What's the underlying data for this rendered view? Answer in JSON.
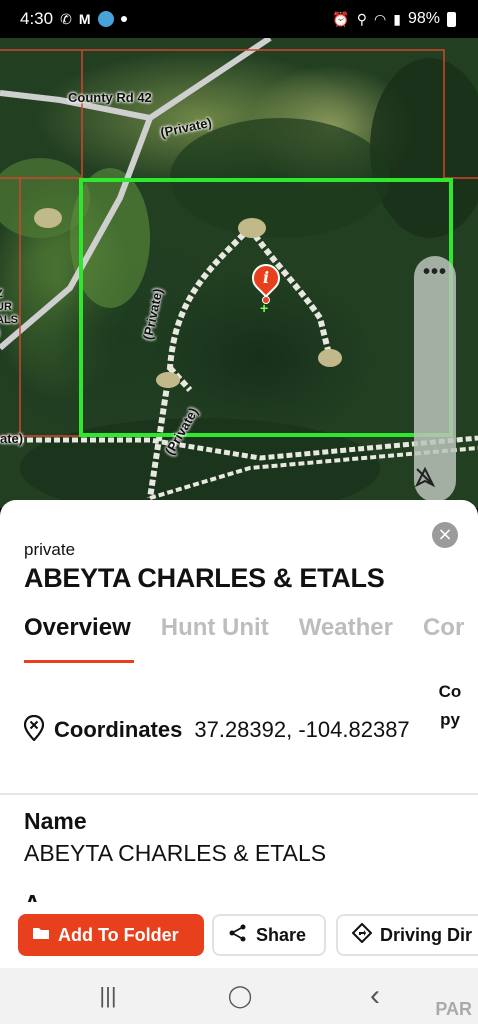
{
  "status_bar": {
    "time": "4:30",
    "battery": "98%",
    "icons": [
      "wifi-call-icon",
      "gmail-icon",
      "location-app-icon",
      "notification-dot-icon",
      "alarm-icon",
      "location-icon",
      "wifi-icon",
      "signal-icon",
      "battery-icon"
    ]
  },
  "map": {
    "labels": {
      "county_road": "County Rd 42",
      "private_road_1": "(Private)",
      "private_road_2": "(Private)",
      "private_road_3": "(Private)",
      "edge_label_1": "ate)",
      "edge_label_2": "Z\nUR\nALS\n)"
    },
    "pin_label": "i",
    "parcel_outline_color": "#2ee82e",
    "boundary_color": "#d2452e",
    "controls": {
      "more_label": "•••"
    }
  },
  "sheet": {
    "close_label": "×",
    "type_label": "private",
    "title": "ABEYTA CHARLES & ETALS",
    "tabs": [
      {
        "label": "Overview",
        "active": true
      },
      {
        "label": "Hunt Unit",
        "active": false
      },
      {
        "label": "Weather",
        "active": false
      },
      {
        "label": "Cor",
        "active": false
      }
    ],
    "coordinates": {
      "label": "Coordinates",
      "value": "37.28392, -104.82387",
      "copy_label": "Copy"
    },
    "name_heading": "Name",
    "name_value": "ABEYTA CHARLES & ETALS",
    "next_heading": "A",
    "actions": {
      "add_to_folder": "Add To Folder",
      "share": "Share",
      "driving_directions": "Driving Dir"
    },
    "accent_color": "#e8401c"
  },
  "nav_bar": {
    "recent_label": "|||",
    "home_label": "◯",
    "back_label": "‹"
  },
  "watermark": "PAR"
}
